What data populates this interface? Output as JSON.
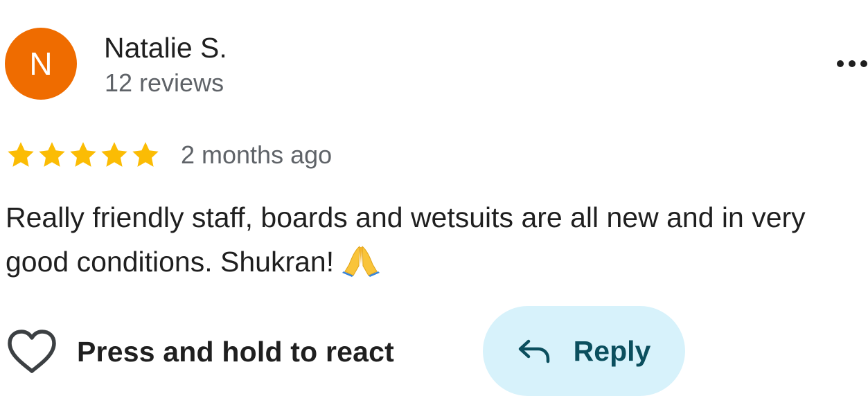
{
  "author": {
    "avatar_initial": "N",
    "avatar_color": "#ef6c00",
    "name": "Natalie S.",
    "meta": "12 reviews"
  },
  "more_menu": {
    "icon": "more-horizontal-icon"
  },
  "rating": {
    "stars": 5,
    "max_stars": 5,
    "star_color": "#fbbc04",
    "timestamp": "2 months ago"
  },
  "review": {
    "text": "Really friendly staff, boards and wetsuits are all new and in very good conditions. Shukran!",
    "emoji": "folded-hands-emoji"
  },
  "actions": {
    "react_icon": "heart-outline-icon",
    "react_label": "Press and hold to react",
    "reply_icon": "reply-arrow-icon",
    "reply_label": "Reply",
    "reply_bg": "#d7f2fb",
    "reply_text_color": "#0b4f5e"
  }
}
